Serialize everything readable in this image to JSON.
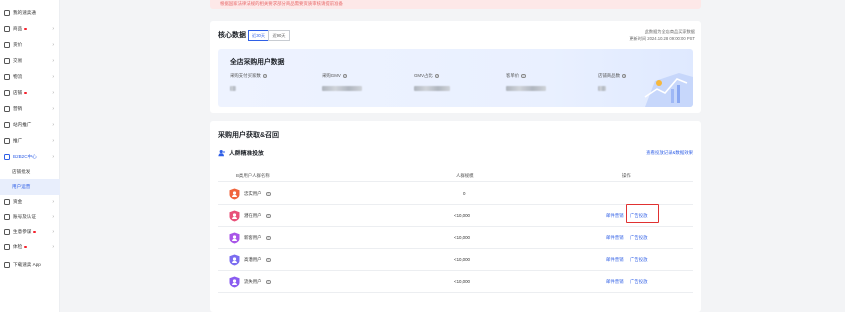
{
  "sidebar": {
    "items": [
      {
        "label": "我的速卖通",
        "dot": false,
        "chev": false
      },
      {
        "label": "商品",
        "dot": true,
        "chev": true
      },
      {
        "label": "货价",
        "dot": false,
        "chev": true
      },
      {
        "label": "交易",
        "dot": false,
        "chev": true
      },
      {
        "label": "物流",
        "dot": false,
        "chev": true
      },
      {
        "label": "店铺",
        "dot": true,
        "chev": true
      },
      {
        "label": "营销",
        "dot": false,
        "chev": true
      },
      {
        "label": "站内推广",
        "dot": false,
        "chev": true
      },
      {
        "label": "推广",
        "dot": false,
        "chev": true
      },
      {
        "label": "B2B2C中心",
        "dot": false,
        "chev": true,
        "active": true
      },
      {
        "label": "店铺批发",
        "dot": false,
        "chev": false,
        "sub": true
      },
      {
        "label": "用户运营",
        "dot": false,
        "chev": false,
        "sub": true,
        "current": true
      },
      {
        "label": "资金",
        "dot": false,
        "chev": true
      },
      {
        "label": "账号及认证",
        "dot": false,
        "chev": true
      },
      {
        "label": "生意参谋",
        "dot": true,
        "chev": true
      },
      {
        "label": "体检",
        "dot": true,
        "chev": true
      },
      {
        "label": "下载速卖 App",
        "dot": false,
        "chev": false
      }
    ]
  },
  "banner": {
    "text": "根据国家法律法规的相关要求部分商品需要资质审核请提前准备"
  },
  "core": {
    "title": "核心数据",
    "range_options": [
      "近30天",
      "近90天"
    ],
    "note": "此数据为全店商品买家数据",
    "updated": "更新时间 2024.10.28 09:00:00 PST",
    "panel_title": "全店采购用户数据",
    "metrics": [
      "采购支付买家数",
      "采购GMV",
      "GMV占比",
      "客单价",
      "店铺商品数"
    ]
  },
  "acquisition": {
    "title": "采购用户获取&召回",
    "subtitle": "人群精准投放",
    "link": "查看投放记录&数据效果",
    "columns": [
      "B类用户人群名称",
      "人群规模",
      "操作"
    ],
    "rows": [
      {
        "name": "忠实用户",
        "size": "0",
        "ops": [],
        "color": "#f0643c"
      },
      {
        "name": "潜在用户",
        "size": "<10,000",
        "ops": [
          "邮件营销",
          "广告投放"
        ],
        "color": "#e8507a",
        "highlight": true
      },
      {
        "name": "新客用户",
        "size": "<10,000",
        "ops": [
          "邮件营销",
          "广告投放"
        ],
        "color": "#a855e8"
      },
      {
        "name": "高潜用户",
        "size": "<10,000",
        "ops": [
          "邮件营销",
          "广告投放"
        ],
        "color": "#7b6cf0"
      },
      {
        "name": "流失用户",
        "size": "<10,000",
        "ops": [
          "邮件营销",
          "广告投放"
        ],
        "color": "#8a5cf0"
      }
    ]
  },
  "colors": {
    "accent": "#2f5fe6",
    "highlight": "#e03131",
    "banner_bg": "#fde8e8"
  }
}
